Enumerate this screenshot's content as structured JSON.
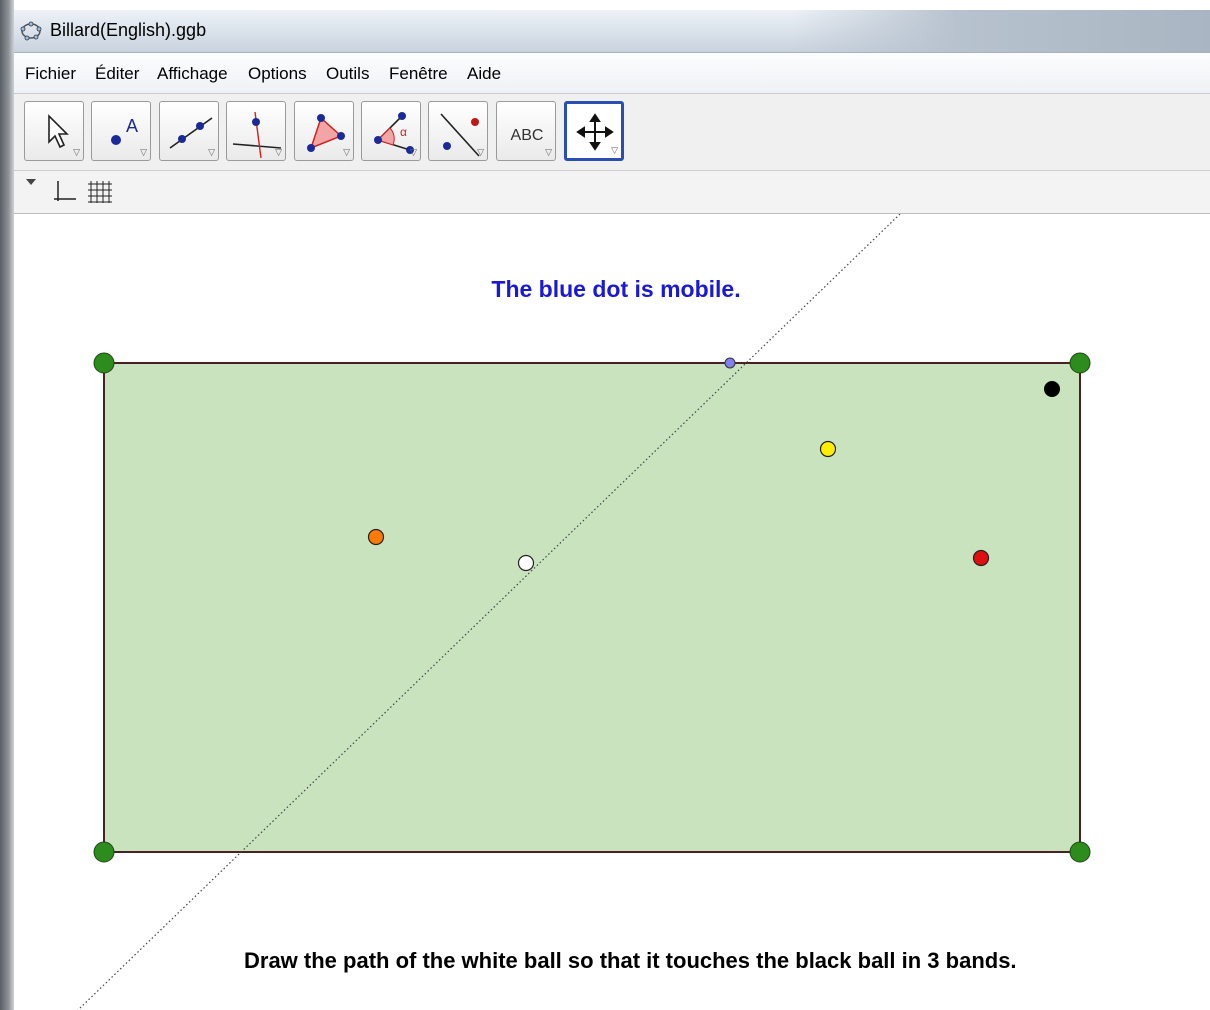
{
  "window": {
    "title": "Billard(English).ggb",
    "app_icon": "geogebra-icon"
  },
  "menu": [
    "Fichier",
    "Éditer",
    "Affichage",
    "Options",
    "Outils",
    "Fenêtre",
    "Aide"
  ],
  "toolbar": {
    "tools": [
      {
        "name": "move-tool",
        "icon": "arrow-cursor-icon"
      },
      {
        "name": "point-tool",
        "icon": "point-A-icon",
        "label": "A"
      },
      {
        "name": "line-tool",
        "icon": "line-through-points-icon"
      },
      {
        "name": "perpendicular-tool",
        "icon": "perpendicular-line-icon"
      },
      {
        "name": "polygon-tool",
        "icon": "polygon-icon"
      },
      {
        "name": "angle-tool",
        "icon": "angle-icon",
        "label": "α"
      },
      {
        "name": "reflect-tool",
        "icon": "reflect-about-line-icon"
      },
      {
        "name": "text-tool",
        "icon": "text-icon",
        "label": "ABC"
      },
      {
        "name": "move-graphics-view-tool",
        "icon": "move-graphics-view-icon",
        "active": true
      }
    ]
  },
  "stylebar": {
    "icons": [
      "axes-icon",
      "grid-icon"
    ]
  },
  "canvas": {
    "instruction_top": "The blue dot is mobile.",
    "instruction_bottom": "Draw the path of the white ball so that it touches the black ball in 3 bands.",
    "colors": {
      "table_fill": "#c9e3bf",
      "table_border": "#4a2020",
      "corner_points": "#2e8b1e",
      "instruction_top": "#1a1ad6",
      "mobile_dot": "#8080ee"
    },
    "balls": [
      {
        "name": "white-ball",
        "color": "#ffffff"
      },
      {
        "name": "black-ball",
        "color": "#000000"
      },
      {
        "name": "yellow-ball",
        "color": "#ffee00"
      },
      {
        "name": "orange-ball",
        "color": "#ff7a00"
      },
      {
        "name": "red-ball",
        "color": "#e01010"
      }
    ]
  }
}
